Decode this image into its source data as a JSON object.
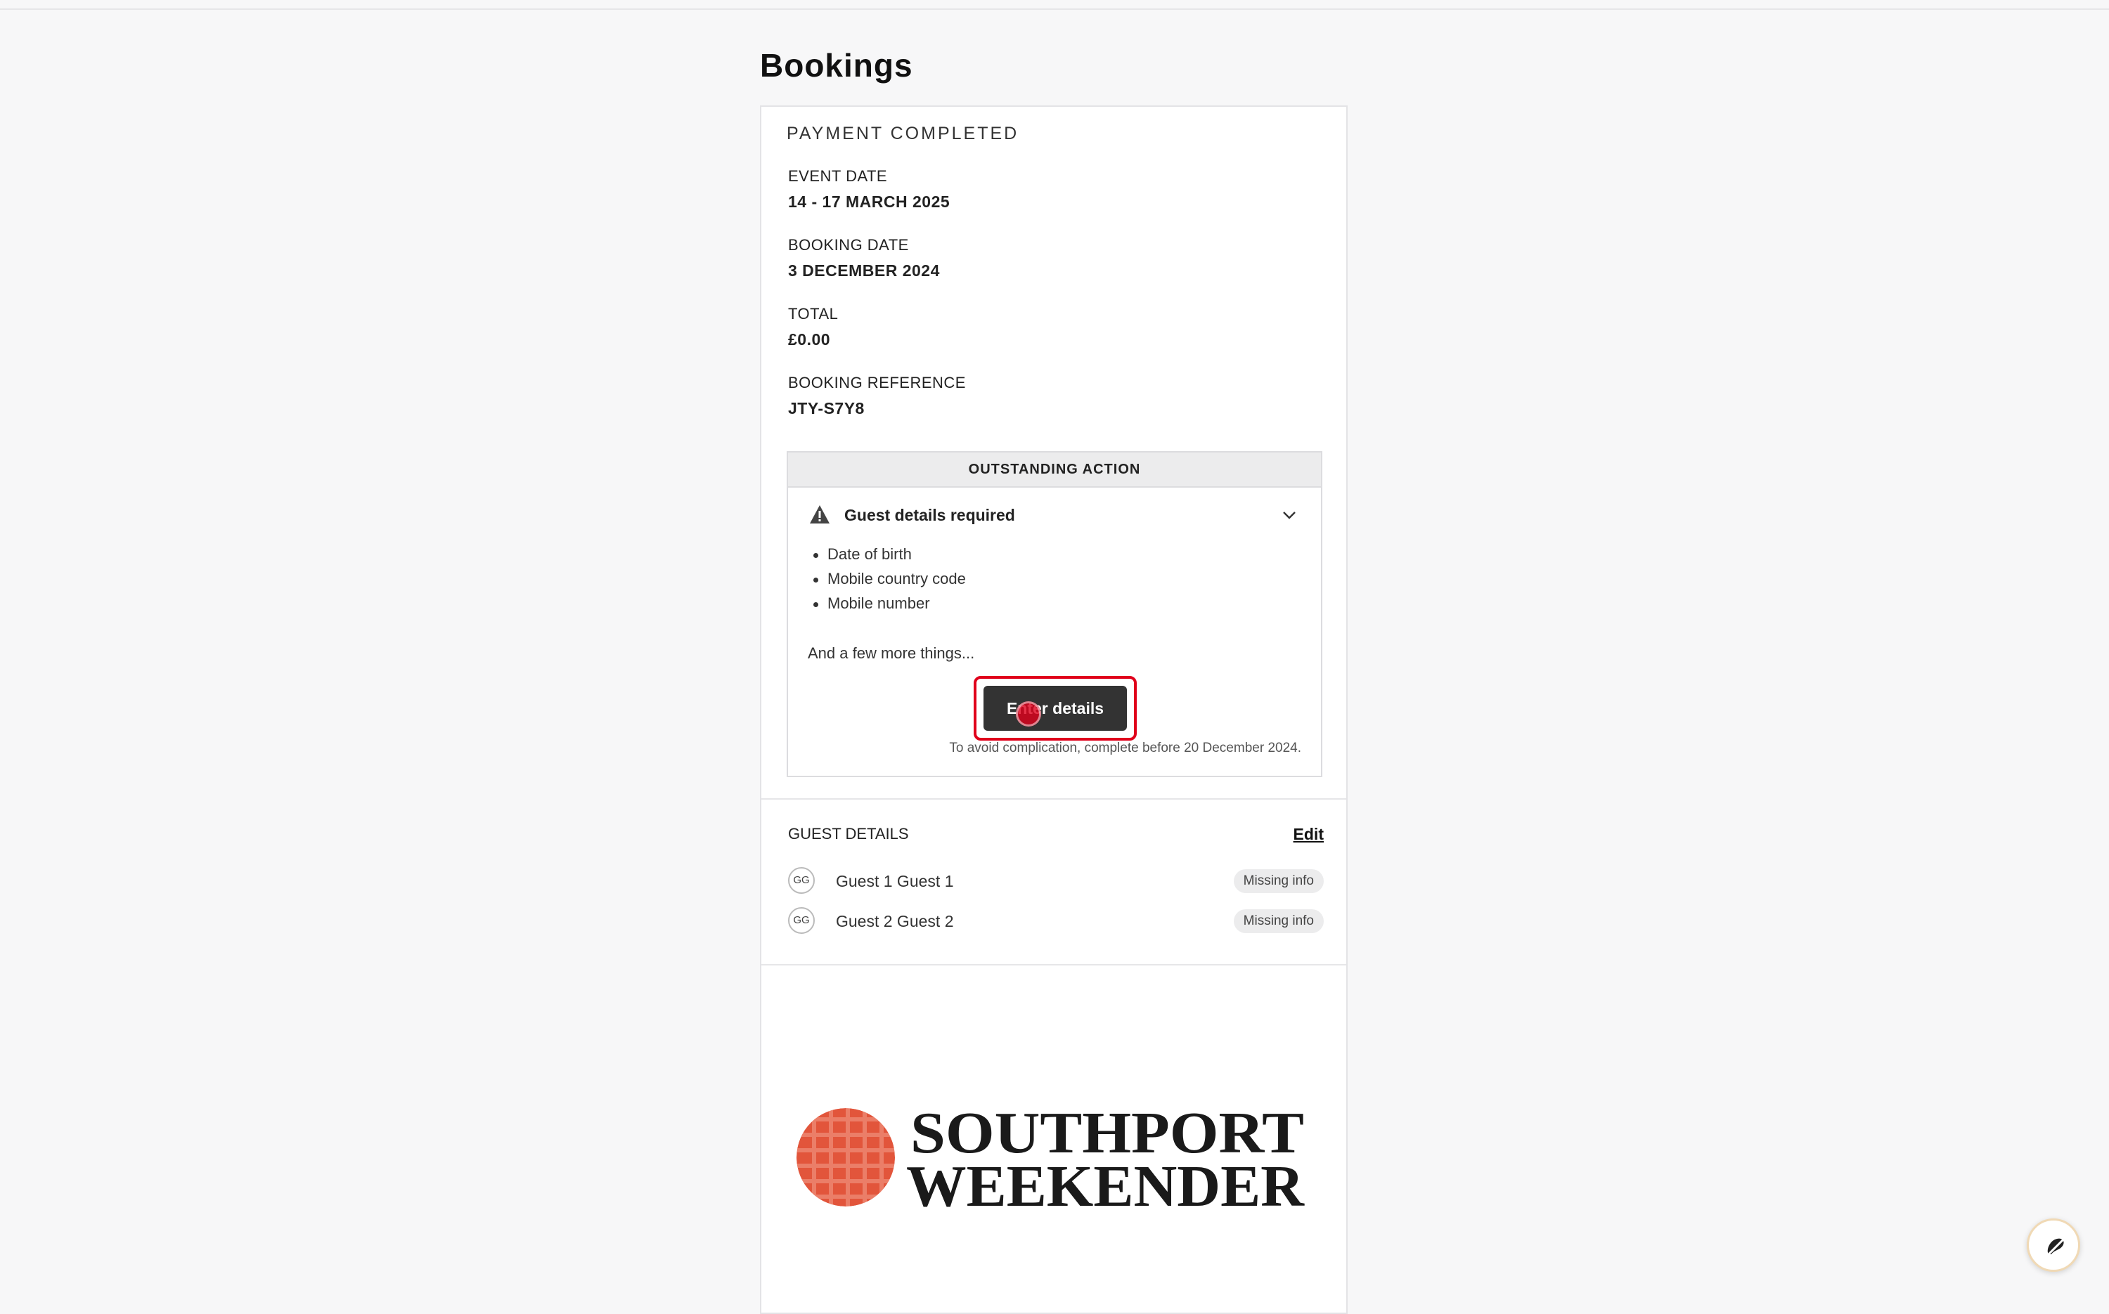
{
  "page": {
    "title": "Bookings"
  },
  "booking": {
    "status": "PAYMENT COMPLETED",
    "event_date_label": "EVENT DATE",
    "event_date_value": "14 - 17 MARCH 2025",
    "booking_date_label": "BOOKING DATE",
    "booking_date_value": "3 DECEMBER 2024",
    "total_label": "TOTAL",
    "total_value": "£0.00",
    "reference_label": "BOOKING REFERENCE",
    "reference_value": "JTY-S7Y8"
  },
  "outstanding_action": {
    "header": "OUTSTANDING ACTION",
    "title": "Guest details required",
    "missing_items": [
      "Date of birth",
      "Mobile country code",
      "Mobile number"
    ],
    "more_text": "And a few more things...",
    "button_label": "Enter details",
    "deadline_text": "To avoid complication, complete before 20 December 2024."
  },
  "guest_details": {
    "label": "GUEST DETAILS",
    "edit_label": "Edit",
    "guests": [
      {
        "initials": "GG",
        "name": "Guest 1 Guest 1",
        "badge": "Missing info"
      },
      {
        "initials": "GG",
        "name": "Guest 2 Guest 2",
        "badge": "Missing info"
      }
    ]
  },
  "logo": {
    "line1": "SOUTHPORT",
    "line2": "WEEKENDER",
    "accent_color": "#e2553b"
  },
  "icons": {
    "warning": "warning-icon",
    "chevron": "chevron-down-icon",
    "help": "help-chat-icon"
  },
  "colors": {
    "button_bg": "#333333",
    "highlight": "#e0001b"
  }
}
